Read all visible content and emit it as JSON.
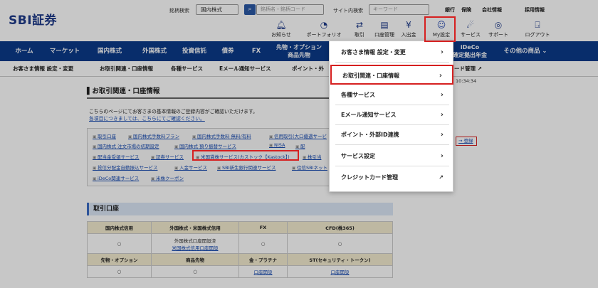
{
  "brand": "SBI証券",
  "search": {
    "stock_label": "銘柄検索",
    "market_value": "国内株式",
    "stock_placeholder": "銘柄名・銘柄コード",
    "site_label": "サイト内検索",
    "site_placeholder": "キーワード"
  },
  "toplinks": [
    "銀行",
    "保険",
    "会社情報",
    "採用情報"
  ],
  "icons": [
    "お知らせ",
    "ポートフォリオ",
    "取引",
    "口座管理",
    "入出金",
    "My設定",
    "サービス",
    "サポート",
    "ログアウト"
  ],
  "nav": [
    "ホーム",
    "マーケット",
    "国内株式",
    "外国株式",
    "投資信託",
    "債券",
    "FX",
    "先物・オプション",
    "商品先物",
    "iDeCo",
    "確定拠出年金",
    "その他の商品"
  ],
  "subnav": [
    "お客さま情報 設定・変更",
    "お取引関連・口座情報",
    "各種サービス",
    "Eメール通知サービス",
    "ポイント・外",
    "ード管理"
  ],
  "content": {
    "title": "お取引関連・口座情報",
    "intro": "こちらのページにてお客さまの基本情報のご登録内容がご確認いただけます。",
    "intro_link": "各項目につきましては、こちらにてご確認ください。",
    "links": [
      [
        "取引口座",
        "国内株式手数料プラン",
        "国内株式手数料 無料/有料",
        "信用取引(大口優遇サービ"
      ],
      [
        "国内株式 注文市場の初期設定",
        "国内株式 預り振替サービス",
        "NISA",
        "配"
      ],
      [
        "配当金受領サービス",
        "証券サービス",
        "米国貸株サービス(カストック【Kastock】)",
        "株引当"
      ],
      [
        "投信分配金自動振込サービス",
        "入金サービス",
        "SBI新生銀行関連サービス",
        "住信SBIネット"
      ],
      [
        "iDeCo関連サービス",
        "米株クーポン"
      ]
    ]
  },
  "section2": "取引口座",
  "table": {
    "row1": [
      "国内株式信用",
      "外国株式・米国株式信用",
      "FX",
      "CFD(株365)"
    ],
    "row2": [
      "○",
      "外国株式口座開設済",
      "○",
      "○"
    ],
    "row2_link": "米国株式信用口座開設",
    "row3": [
      "先物・オプション",
      "商品先物",
      "金・プラチナ",
      "ST(セキュリティ・トークン)"
    ],
    "row4": [
      "○",
      "○",
      "口座開設",
      "口座開設"
    ]
  },
  "dropdown": [
    "お客さま情報 設定・変更",
    "お取引関連・口座情報",
    "各種サービス",
    "Eメール通知サービス",
    "ポイント・外部ID連携",
    "サービス設定",
    "クレジットカード管理"
  ],
  "time": "10:34:34",
  "side_link": "登録"
}
